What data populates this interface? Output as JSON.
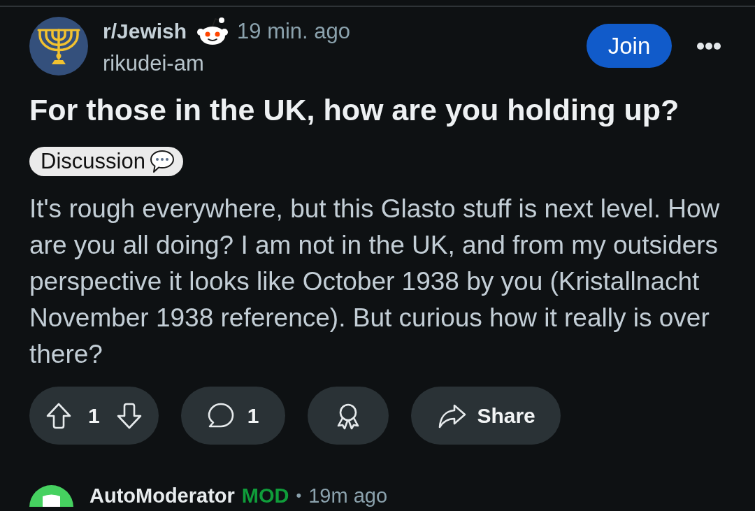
{
  "post": {
    "subreddit": "r/Jewish",
    "time": "19 min. ago",
    "author": "rikudei-am",
    "join_button": "Join",
    "title": "For those in the UK, how are you holding up?",
    "flair": "Discussion",
    "body": "It's rough everywhere, but this Glasto stuff is next level. How are you all doing? I am not in the UK, and from my outsiders perspective it looks like October 1938 by you (Kristallnacht November 1938 reference). But curious how it really is over there?",
    "actions": [
      {
        "kind": "vote",
        "count": "1"
      },
      {
        "kind": "comments",
        "count": "1"
      },
      {
        "kind": "award"
      },
      {
        "kind": "share",
        "label": "Share"
      }
    ]
  },
  "comment": {
    "author": "AutoModerator",
    "badge": "MOD",
    "separator": "•",
    "time": "19m ago"
  }
}
